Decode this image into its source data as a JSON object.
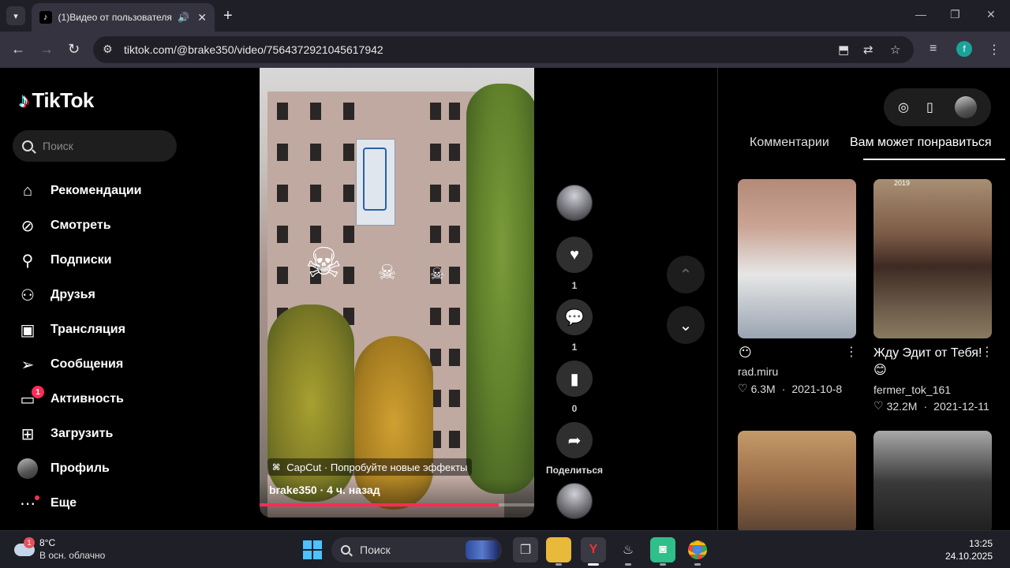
{
  "browser": {
    "tab_title": "(1)Видео от пользователя",
    "url": "tiktok.com/@brake350/video/7564372921045617942",
    "profile_initial": "f"
  },
  "sidebar": {
    "brand": "TikTok",
    "search_placeholder": "Поиск",
    "items": [
      {
        "label": "Рекомендации",
        "icon": "home-icon"
      },
      {
        "label": "Смотреть",
        "icon": "compass-icon"
      },
      {
        "label": "Подписки",
        "icon": "following-icon"
      },
      {
        "label": "Друзья",
        "icon": "friends-icon"
      },
      {
        "label": "Трансляция",
        "icon": "live-icon"
      },
      {
        "label": "Сообщения",
        "icon": "messages-icon"
      },
      {
        "label": "Активность",
        "icon": "activity-icon",
        "badge": "1"
      },
      {
        "label": "Загрузить",
        "icon": "upload-icon"
      },
      {
        "label": "Профиль",
        "icon": "avatar"
      },
      {
        "label": "Еще",
        "icon": "more-icon"
      }
    ]
  },
  "video": {
    "effect_label": "CapCut · Попробуйте новые эффекты",
    "author_line": "brake350 · 4 ч. назад",
    "progress": 0.87,
    "likes": "1",
    "comments": "1",
    "bookmarks": "0",
    "share_label": "Поделиться"
  },
  "right_panel": {
    "tabs": [
      {
        "label": "Комментарии",
        "active": false
      },
      {
        "label": "Вам может понравиться",
        "active": true
      }
    ],
    "cards": [
      {
        "title": "😶",
        "author": "rad.miru",
        "likes": "6.3M",
        "date": "2021-10-8"
      },
      {
        "title": "Жду Эдит от Тебя!",
        "title2": "😊",
        "author": "fermer_tok_161",
        "likes": "32.2M",
        "date": "2021-12-11",
        "stamp": "2019"
      }
    ]
  },
  "taskbar": {
    "weather_badge": "1",
    "temperature": "8°C",
    "weather_text": "В осн. облачно",
    "search_label": "Поиск",
    "time": "13:25",
    "date": "24.10.2025"
  },
  "colors": {
    "accent": "#fe2c55",
    "brand_cyan": "#25f4ee"
  }
}
